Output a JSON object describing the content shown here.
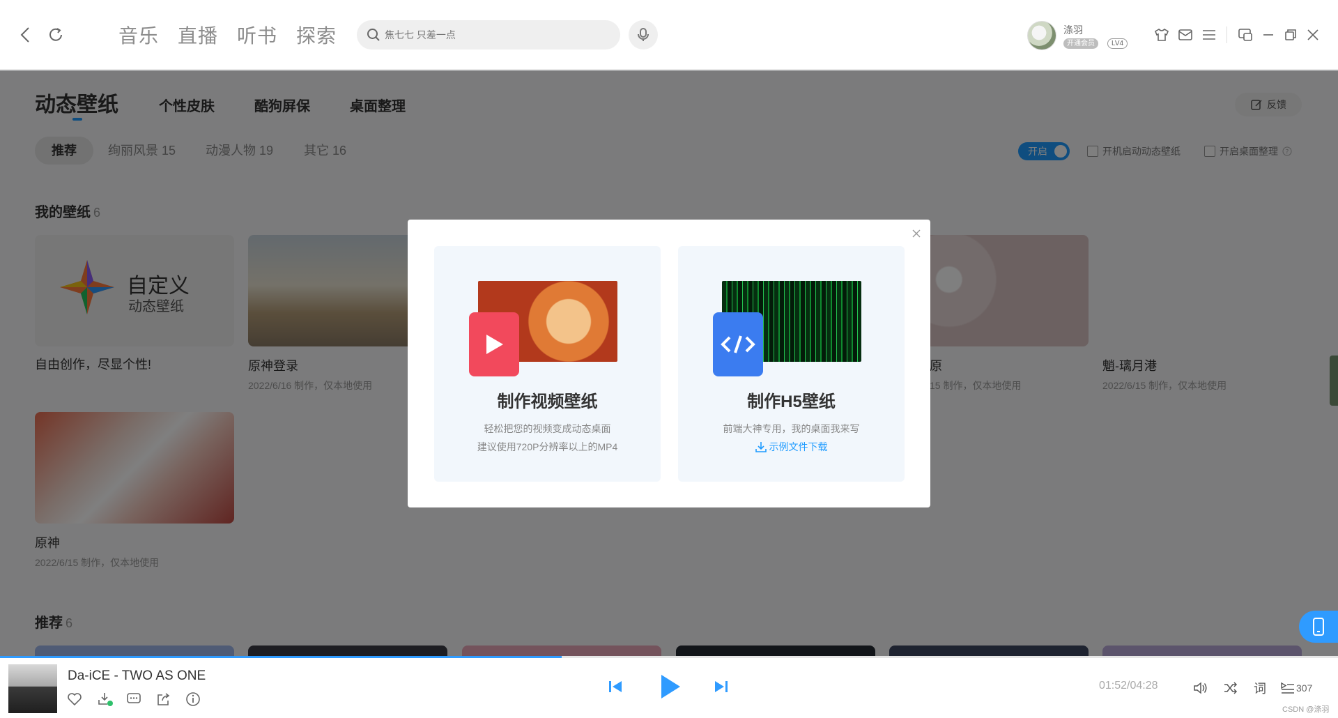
{
  "topbar": {
    "nav_tabs": [
      "音乐",
      "直播",
      "听书",
      "探索"
    ],
    "search_placeholder": "焦七七 只差一点",
    "user": {
      "name": "涤羽",
      "vip": "开通会员",
      "level": "LV4"
    }
  },
  "page": {
    "tabs": [
      "动态壁纸",
      "个性皮肤",
      "酷狗屏保",
      "桌面整理"
    ],
    "feedback": "反馈",
    "chips": [
      "推荐",
      "绚丽风景 15",
      "动漫人物 19",
      "其它 16"
    ],
    "toggle_label": "开启",
    "checkbox_autostart": "开机启动动态壁纸",
    "checkbox_desktop": "开启桌面整理",
    "my_section": {
      "title": "我的壁纸",
      "count": "6"
    },
    "custom_card": {
      "line1": "自定义",
      "line2": "动态壁纸",
      "caption": "自由创作，尽显个性!"
    },
    "cards": [
      {
        "title": "原神登录",
        "sub": "2022/6/16 制作，仅本地使用"
      },
      {
        "title": "原",
        "sub": "15 制作，仅本地使用"
      },
      {
        "title": "魈-璃月港",
        "sub": "2022/6/15 制作，仅本地使用"
      },
      {
        "title": "原神",
        "sub": "2022/6/15 制作，仅本地使用"
      }
    ],
    "rec_section": {
      "title": "推荐",
      "count": "6"
    }
  },
  "dialog": {
    "video": {
      "title": "制作视频壁纸",
      "desc1": "轻松把您的视频变成动态桌面",
      "desc2": "建议使用720P分辨率以上的MP4"
    },
    "h5": {
      "title": "制作H5壁纸",
      "desc1": "前端大神专用，我的桌面我来写",
      "link": "示例文件下载"
    }
  },
  "player": {
    "song": "Da-iCE - TWO AS ONE",
    "time": "01:52/04:28",
    "progress": 0.42,
    "lyrics_label": "词",
    "playlist_count": "307",
    "watermark": "CSDN @涤羽"
  },
  "colors": {
    "accent": "#1e9bff",
    "video_badge": "#f2495c",
    "h5_badge": "#3b7cf0"
  }
}
